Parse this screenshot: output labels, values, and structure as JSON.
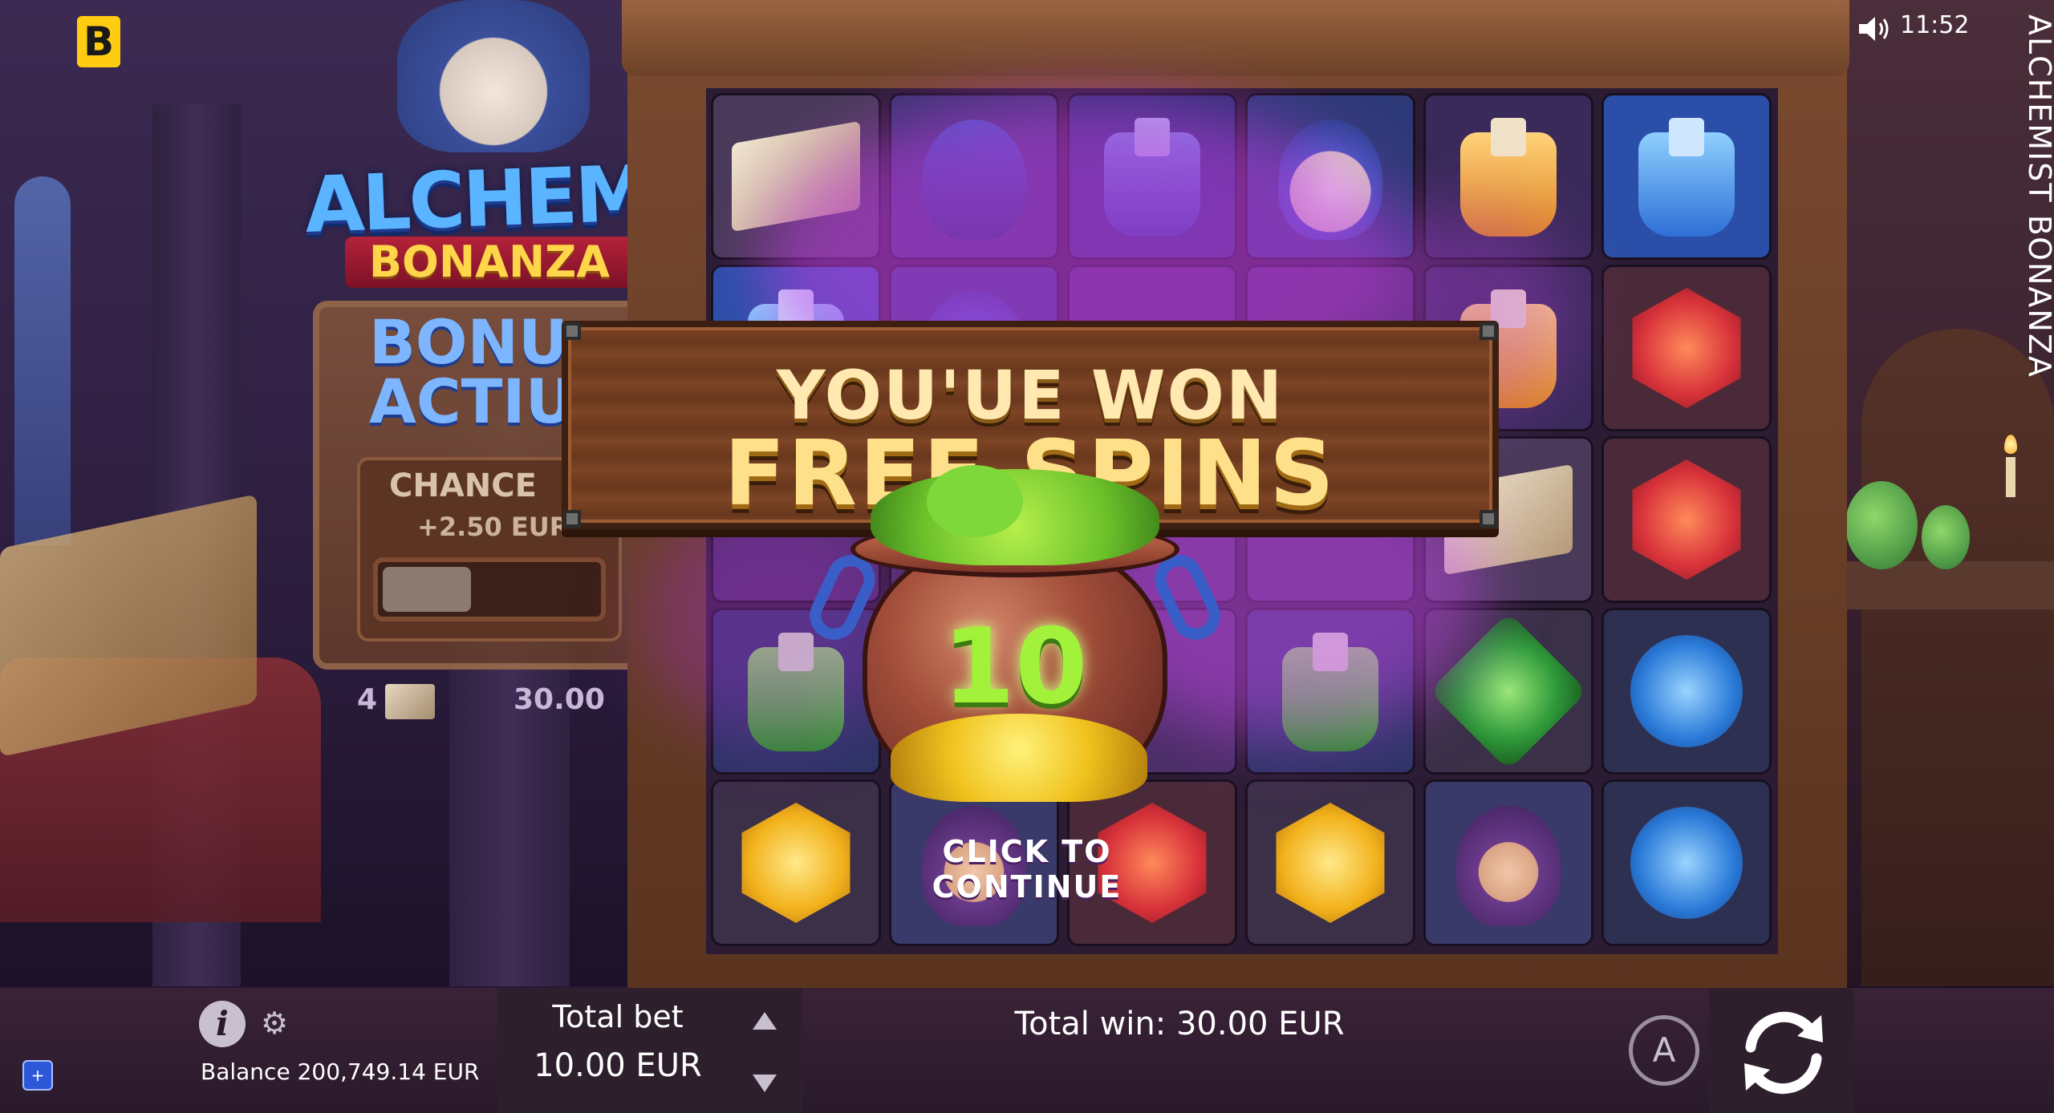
{
  "app": {
    "brand_letter": "B",
    "game_title": "ALCHEMIST BONANZA",
    "clock": "11:52"
  },
  "logo": {
    "title": "ALCHEMIST",
    "subtitle": "BONANZA"
  },
  "bonus_board": {
    "heading": "BONU ACTIU",
    "chance_label": "CHANCE",
    "chance_value": "+2.50 EUR",
    "book_count": "4",
    "book_payout": "30.00"
  },
  "win_popup": {
    "line1": "YOU'UE WON",
    "line2": "FREE SPINS",
    "free_spins": "10",
    "continue_label": "CLICK TO CONTINUE"
  },
  "footer": {
    "balance": "Balance 200,749.14 EUR",
    "total_bet_label": "Total bet",
    "total_bet_value": "10.00 EUR",
    "total_win": "Total win: 30.00 EUR",
    "autoplay_label": "A",
    "fullscreen_label": "+"
  },
  "reels": [
    [
      "book",
      "wizard-hat",
      "bottle-blue-dark",
      "wizard",
      "bottle-orange",
      "bottle-blue"
    ],
    [
      "bottle-blue",
      "wizard",
      "",
      "",
      "bottle-orange",
      "hex-red"
    ],
    [
      "",
      "",
      "",
      "",
      "book",
      "hex-red"
    ],
    [
      "bottle-green",
      "",
      "",
      "bottle-green",
      "gem-green",
      "gem-blue"
    ],
    [
      "hex-yellow",
      "witch",
      "hex-red",
      "hex-yellow",
      "witch",
      "gem-blue"
    ]
  ],
  "colors": {
    "accent_gold": "#ffe08a",
    "goo_green": "#a2f23c",
    "brand_yellow": "#ffcc12"
  },
  "icons": {
    "sound": "speaker-icon",
    "info": "info-icon",
    "settings": "gear-icon",
    "spin": "refresh-icon",
    "fullscreen": "fullscreen-icon"
  }
}
